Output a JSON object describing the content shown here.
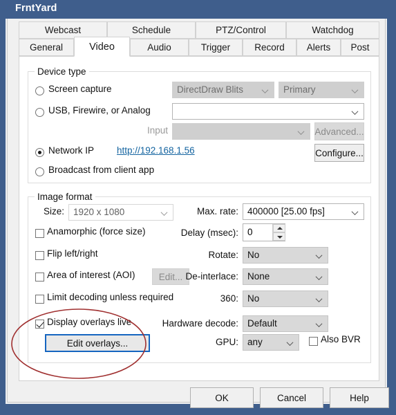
{
  "window": {
    "title": "FrntYard",
    "accent": "#3f5e8c"
  },
  "tabs": {
    "row1": [
      {
        "label": "Webcast"
      },
      {
        "label": "Schedule"
      },
      {
        "label": "PTZ/Control"
      },
      {
        "label": "Watchdog"
      }
    ],
    "row2": [
      {
        "label": "General"
      },
      {
        "label": "Video"
      },
      {
        "label": "Audio"
      },
      {
        "label": "Trigger"
      },
      {
        "label": "Record"
      },
      {
        "label": "Alerts"
      },
      {
        "label": "Post"
      }
    ],
    "active": "Video"
  },
  "device_type": {
    "title": "Device type",
    "screen_capture": {
      "label": "Screen capture",
      "selected": false
    },
    "screen_capture_method": {
      "value": "DirectDraw Blits",
      "disabled": true
    },
    "screen_capture_monitor": {
      "value": "Primary",
      "disabled": true
    },
    "usb": {
      "label": "USB, Firewire, or Analog",
      "selected": false
    },
    "usb_device": {
      "value": "",
      "disabled": false
    },
    "input_label": "Input",
    "input_value": "",
    "advanced_button": "Advanced...",
    "network_ip": {
      "label": "Network IP",
      "selected": true
    },
    "network_url": "http://192.168.1.56",
    "configure_button": "Configure...",
    "broadcast": {
      "label": "Broadcast from client app",
      "selected": false
    }
  },
  "image_format": {
    "title": "Image format",
    "size_label": "Size:",
    "size_value": "1920 x 1080",
    "anamorphic": {
      "label": "Anamorphic (force size)",
      "checked": false
    },
    "flip": {
      "label": "Flip left/right",
      "checked": false
    },
    "aoi": {
      "label": "Area of interest (AOI)",
      "checked": false
    },
    "aoi_edit_button": "Edit...",
    "limit_decoding": {
      "label": "Limit decoding unless required",
      "checked": false
    },
    "display_overlays": {
      "label": "Display overlays live",
      "checked": true
    },
    "edit_overlays_button": "Edit overlays...",
    "max_rate_label": "Max. rate:",
    "max_rate_value": "400000 [25.00 fps]",
    "delay_label": "Delay (msec):",
    "delay_value": "0",
    "rotate_label": "Rotate:",
    "rotate_value": "No",
    "deinterlace_label": "De-interlace:",
    "deinterlace_value": "None",
    "threesixty_label": "360:",
    "threesixty_value": "No",
    "hardware_decode_label": "Hardware decode:",
    "hardware_decode_value": "Default",
    "gpu_label": "GPU:",
    "gpu_value": "any",
    "also_bvr": {
      "label": "Also BVR",
      "checked": false
    }
  },
  "footer": {
    "ok": "OK",
    "cancel": "Cancel",
    "help": "Help"
  },
  "annotation": {
    "shape": "ellipse",
    "color": "#a03030"
  }
}
